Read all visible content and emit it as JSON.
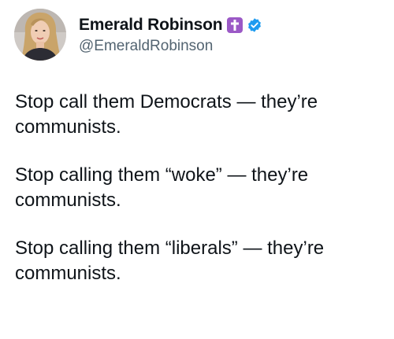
{
  "author": {
    "display_name": "Emerald Robinson",
    "handle": "@EmeraldRobinson",
    "badges": [
      "latin-cross-emoji",
      "verified-icon"
    ],
    "colors": {
      "verified": "#1d9bf0",
      "cross_emoji_bg": "#9b59c6",
      "handle": "#536471",
      "text": "#0f1419"
    }
  },
  "tweet": {
    "paragraphs": [
      "Stop call them Democrats — they’re communists.",
      "Stop calling them “woke” — they’re communists.",
      "Stop calling them “liberals” — they’re communists."
    ]
  }
}
